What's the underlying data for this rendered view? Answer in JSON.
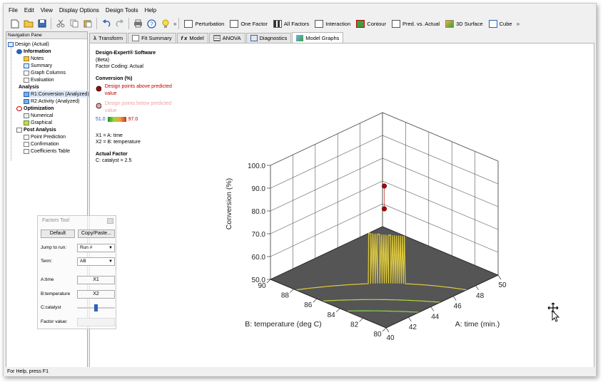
{
  "menu": [
    "File",
    "Edit",
    "View",
    "Display Options",
    "Design Tools",
    "Help"
  ],
  "toolbar": {
    "icons": [
      "new-file-icon",
      "open-folder-icon",
      "save-icon",
      "cut-icon",
      "copy-icon",
      "paste-icon",
      "undo-icon",
      "redo-icon",
      "print-icon",
      "help-icon",
      "tip-lightbulb-icon"
    ],
    "graph_buttons": [
      "Perturbation",
      "One Factor",
      "All Factors",
      "Interaction",
      "Contour",
      "Pred. vs. Actual",
      "3D Surface",
      "Cube"
    ],
    "overflow": "»"
  },
  "nav": {
    "title": "Navigation Pane",
    "items": [
      {
        "label": "Design (Actual)",
        "bold": false
      },
      {
        "label": "Information",
        "bold": true
      },
      {
        "label": "Notes",
        "bold": false
      },
      {
        "label": "Summary",
        "bold": false
      },
      {
        "label": "Graph Columns",
        "bold": false
      },
      {
        "label": "Evaluation",
        "bold": false
      },
      {
        "label": "Analysis",
        "bold": true
      },
      {
        "label": "R1:Conversion (Analyzed)",
        "bold": false
      },
      {
        "label": "R2:Activity (Analyzed)",
        "bold": false
      },
      {
        "label": "Optimization",
        "bold": true
      },
      {
        "label": "Numerical",
        "bold": false
      },
      {
        "label": "Graphical",
        "bold": false
      },
      {
        "label": "Post Analysis",
        "bold": true
      },
      {
        "label": "Point Prediction",
        "bold": false
      },
      {
        "label": "Confirmation",
        "bold": false
      },
      {
        "label": "Coefficients Table",
        "bold": false
      }
    ]
  },
  "factors_tool": {
    "title": "Factors Tool",
    "default_button": "Default",
    "copy_button": "Copy/Paste...",
    "jump_label": "Jump to run:",
    "jump_value": "Run #",
    "term_label": "Term:",
    "term_value": "AB",
    "a_label": "A:time",
    "a_value": "X1",
    "b_label": "B:temperature",
    "b_value": "X2",
    "c_label": "C:catalyst",
    "c_slider_level": 0.5,
    "factor_value_label": "Factor value:"
  },
  "tabs": [
    "Transform",
    "Fit Summary",
    "Model",
    "ANOVA",
    "Diagnostics",
    "Model Graphs"
  ],
  "tab_icons": {
    "Transform": "λ",
    "Model": "f x"
  },
  "active_tab": "Model Graphs",
  "info": {
    "software": "Design-Expert® Software",
    "beta": "(Beta)",
    "coding": "Factor Coding: Actual",
    "response": "Conversion (%)",
    "above": "Design points above predicted value",
    "below": "Design points below predicted value",
    "scale_min": "51.0",
    "scale_max": "97.0",
    "x1": "X1 = A: time",
    "x2": "X2 = B: temperature",
    "actual_factor": "Actual Factor",
    "catalyst": "C: catalyst = 2.5"
  },
  "chart_data": {
    "type": "surface",
    "zlabel": "Conversion (%)",
    "xlabel": "A: time (min.)",
    "ylabel": "B: temperature (deg C)",
    "x_ticks": [
      "40",
      "42",
      "44",
      "46",
      "48",
      "50"
    ],
    "y_ticks": [
      "80",
      "82",
      "84",
      "86",
      "88",
      "90"
    ],
    "z_ticks": [
      "50.0",
      "60.0",
      "70.0",
      "80.0",
      "90.0",
      "100.0"
    ],
    "x_range": [
      40,
      50
    ],
    "y_range": [
      80,
      90
    ],
    "z_range": [
      50,
      100
    ],
    "design_points": [
      {
        "x": 45,
        "y": 85,
        "z": 90,
        "position": "above"
      },
      {
        "x": 45,
        "y": 85,
        "z": 80,
        "position": "above"
      }
    ]
  },
  "colors": {
    "surface_low": "#2e8b23",
    "surface_mid": "#9dd63b",
    "surface_high": "#f1a13b",
    "floor": "#555555",
    "point_above": "#b00000",
    "point_below": "#f2a0a0"
  },
  "status": "For Help, press F1"
}
